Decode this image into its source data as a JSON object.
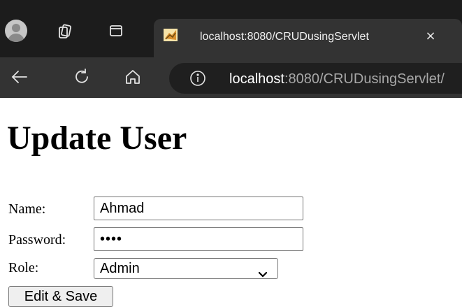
{
  "browser": {
    "tab": {
      "title": "localhost:8080/CRUDusingServlet",
      "close_glyph": "×",
      "favicon": "tomcat-icon"
    },
    "address_bar": {
      "host": "localhost",
      "rest": ":8080/CRUDusingServlet/",
      "info_icon": "info-icon"
    },
    "icons": [
      "profile-avatar",
      "collections-icon",
      "tab-actions-icon",
      "back-icon",
      "reload-icon",
      "home-icon"
    ],
    "colors": {
      "frame": "#1c1c1c",
      "toolbar": "#333333",
      "addressbar": "#1f1f1f"
    }
  },
  "page": {
    "title": "Update User",
    "form": {
      "name_label": "Name:",
      "name_value": "Ahmad",
      "password_label": "Password:",
      "password_value": "••••",
      "role_label": "Role:",
      "role_value": "Admin",
      "submit_label": "Edit & Save"
    }
  }
}
